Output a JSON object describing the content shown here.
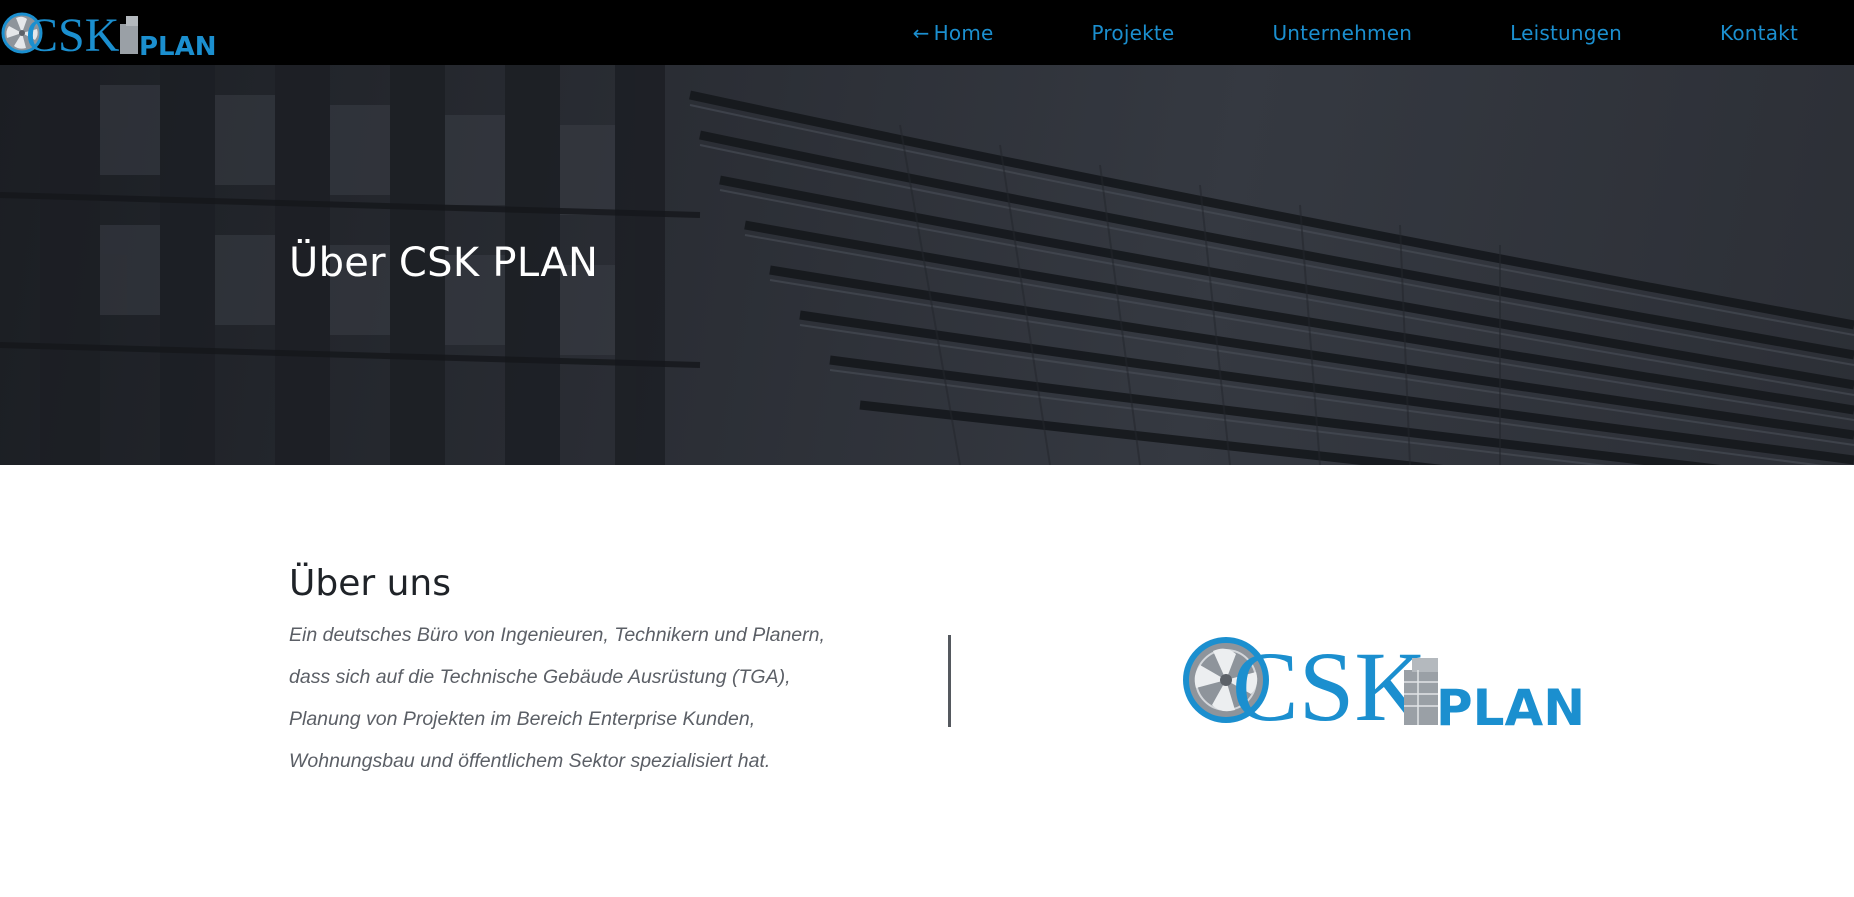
{
  "brand": {
    "name": "CSK PLAN",
    "logo_main": "CSK",
    "logo_sub": "PLAN",
    "color_blue": "#1b8fcf",
    "color_grey": "#8e949b"
  },
  "nav": {
    "items": [
      {
        "label": "Home",
        "icon": "arrow-left-icon",
        "arrow": "←"
      },
      {
        "label": "Projekte"
      },
      {
        "label": "Unternehmen"
      },
      {
        "label": "Leistungen"
      },
      {
        "label": "Kontakt"
      }
    ]
  },
  "hero": {
    "title": "Über CSK PLAN"
  },
  "about": {
    "title": "Über uns",
    "lines": [
      "Ein deutsches Büro von Ingenieuren, Technikern und Planern,",
      "dass sich auf die Technische Gebäude Ausrüstung (TGA),",
      "Planung von Projekten im Bereich Enterprise Kunden,",
      "Wohnungsbau und öffentlichem Sektor spezialisiert hat."
    ]
  }
}
